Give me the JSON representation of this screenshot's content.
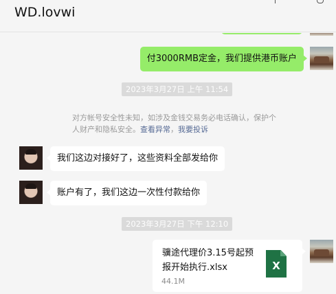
{
  "window": {
    "title": "WD.lovwi"
  },
  "messages": [
    {
      "type": "text",
      "side": "self",
      "text": "付3000RMB定金，我们提供港币账户"
    },
    {
      "type": "time",
      "text": "2023年3月27日 上午 11:54"
    },
    {
      "type": "system",
      "text": "对方帐号安全性未知，如涉及金钱交易务必电话确认，保护个人财产和隐私安全。",
      "link1": "查看异常",
      "link2": "我要投诉"
    },
    {
      "type": "text",
      "side": "other",
      "text": "我们这边对接好了，这些资料全部发给你"
    },
    {
      "type": "text",
      "side": "other",
      "text": "账户有了，我们这边一次性付款给你"
    },
    {
      "type": "time",
      "text": "2023年3月27日 下午 12:10"
    },
    {
      "type": "file",
      "side": "self",
      "name": "骥途代理价3.15号起预报开始执行.xlsx",
      "size": "44.1M",
      "icon": "excel-file-icon",
      "icon_letter": "X"
    }
  ],
  "colors": {
    "self_bubble": "#95ec69",
    "other_bubble": "#ffffff",
    "background": "#f5f5f5",
    "link": "#576b95",
    "excel": "#1f7244"
  }
}
